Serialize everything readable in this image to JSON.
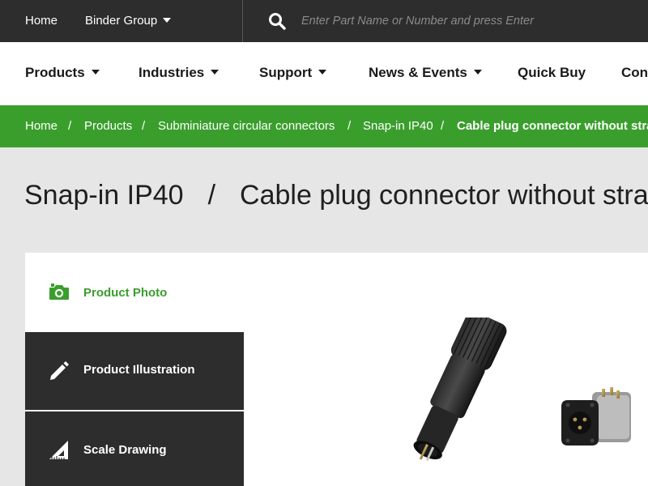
{
  "topbar": {
    "home_label": "Home",
    "group_label": "Binder Group",
    "search_placeholder": "Enter Part Name or Number and press Enter"
  },
  "nav": {
    "items": [
      {
        "label": "Products",
        "dropdown": true
      },
      {
        "label": "Industries",
        "dropdown": true
      },
      {
        "label": "Support",
        "dropdown": true
      },
      {
        "label": "News & Events",
        "dropdown": true
      },
      {
        "label": "Quick Buy",
        "dropdown": false
      },
      {
        "label": "Cont",
        "dropdown": false
      }
    ]
  },
  "breadcrumb": {
    "separator": "/",
    "items": [
      "Home",
      "Products",
      "Subminiature circular connectors",
      "Snap-in IP40"
    ],
    "current": "Cable plug connector without stra"
  },
  "page": {
    "title_part1": "Snap-in IP40",
    "title_separator": "/",
    "title_part2": "Cable plug connector without stra"
  },
  "media_tabs": [
    {
      "label": "Product Photo",
      "icon": "camera-icon",
      "active": true
    },
    {
      "label": "Product Illustration",
      "icon": "pencil-icon",
      "active": false
    },
    {
      "label": "Scale Drawing",
      "icon": "ruler-triangle-icon",
      "active": false
    }
  ],
  "colors": {
    "brand_green": "#3a9e2c",
    "dark_bar": "#2d2d2d",
    "page_bg": "#e5e6e5"
  }
}
